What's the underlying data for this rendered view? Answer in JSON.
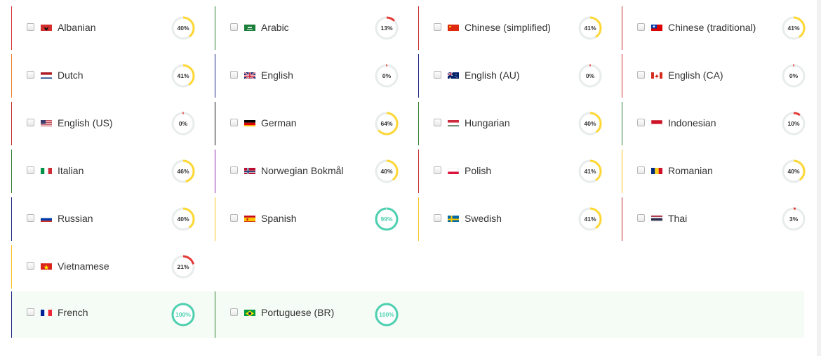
{
  "languages": [
    {
      "name": "Albanian",
      "percent": 40,
      "border": "#d32f2f",
      "flag": "al"
    },
    {
      "name": "Arabic",
      "percent": 13,
      "border": "#2e7d32",
      "flag": "sa"
    },
    {
      "name": "Chinese (simplified)",
      "percent": 41,
      "border": "#c62828",
      "flag": "cn"
    },
    {
      "name": "Chinese (traditional)",
      "percent": 41,
      "border": "#c62828",
      "flag": "tw"
    },
    {
      "name": "Dutch",
      "percent": 41,
      "border": "#e67e22",
      "flag": "nl"
    },
    {
      "name": "English",
      "percent": 0,
      "border": "#1a237e",
      "flag": "gb"
    },
    {
      "name": "English (AU)",
      "percent": 0,
      "border": "#1a237e",
      "flag": "au"
    },
    {
      "name": "English (CA)",
      "percent": 0,
      "border": "#d32f2f",
      "flag": "ca"
    },
    {
      "name": "English (US)",
      "percent": 0,
      "border": "#c62828",
      "flag": "us"
    },
    {
      "name": "German",
      "percent": 64,
      "border": "#111111",
      "flag": "de"
    },
    {
      "name": "Hungarian",
      "percent": 40,
      "border": "#2e7d32",
      "flag": "hu"
    },
    {
      "name": "Indonesian",
      "percent": 10,
      "border": "#2e7d32",
      "flag": "id"
    },
    {
      "name": "Italian",
      "percent": 46,
      "border": "#2e7d32",
      "flag": "it"
    },
    {
      "name": "Norwegian Bokmål",
      "percent": 40,
      "border": "#8e24aa",
      "flag": "no"
    },
    {
      "name": "Polish",
      "percent": 41,
      "border": "#c62828",
      "flag": "pl"
    },
    {
      "name": "Romanian",
      "percent": 40,
      "border": "#f9c21b",
      "flag": "ro"
    },
    {
      "name": "Russian",
      "percent": 40,
      "border": "#1a237e",
      "flag": "ru"
    },
    {
      "name": "Spanish",
      "percent": 99,
      "border": "#f9c21b",
      "flag": "es"
    },
    {
      "name": "Swedish",
      "percent": 41,
      "border": "#f9c21b",
      "flag": "se"
    },
    {
      "name": "Thai",
      "percent": 3,
      "border": "#c62828",
      "flag": "th"
    },
    {
      "name": "Vietnamese",
      "percent": 21,
      "border": "#f9c21b",
      "flag": "vn"
    }
  ],
  "completed": [
    {
      "name": "French",
      "percent": 100,
      "border": "#1a237e",
      "flag": "fr"
    },
    {
      "name": "Portuguese (BR)",
      "percent": 100,
      "border": "#2e7d32",
      "flag": "br"
    }
  ],
  "colors": {
    "low": "#e53935",
    "mid": "#fdd835",
    "high": "#4dd0b0",
    "track": "#e8ecec"
  }
}
